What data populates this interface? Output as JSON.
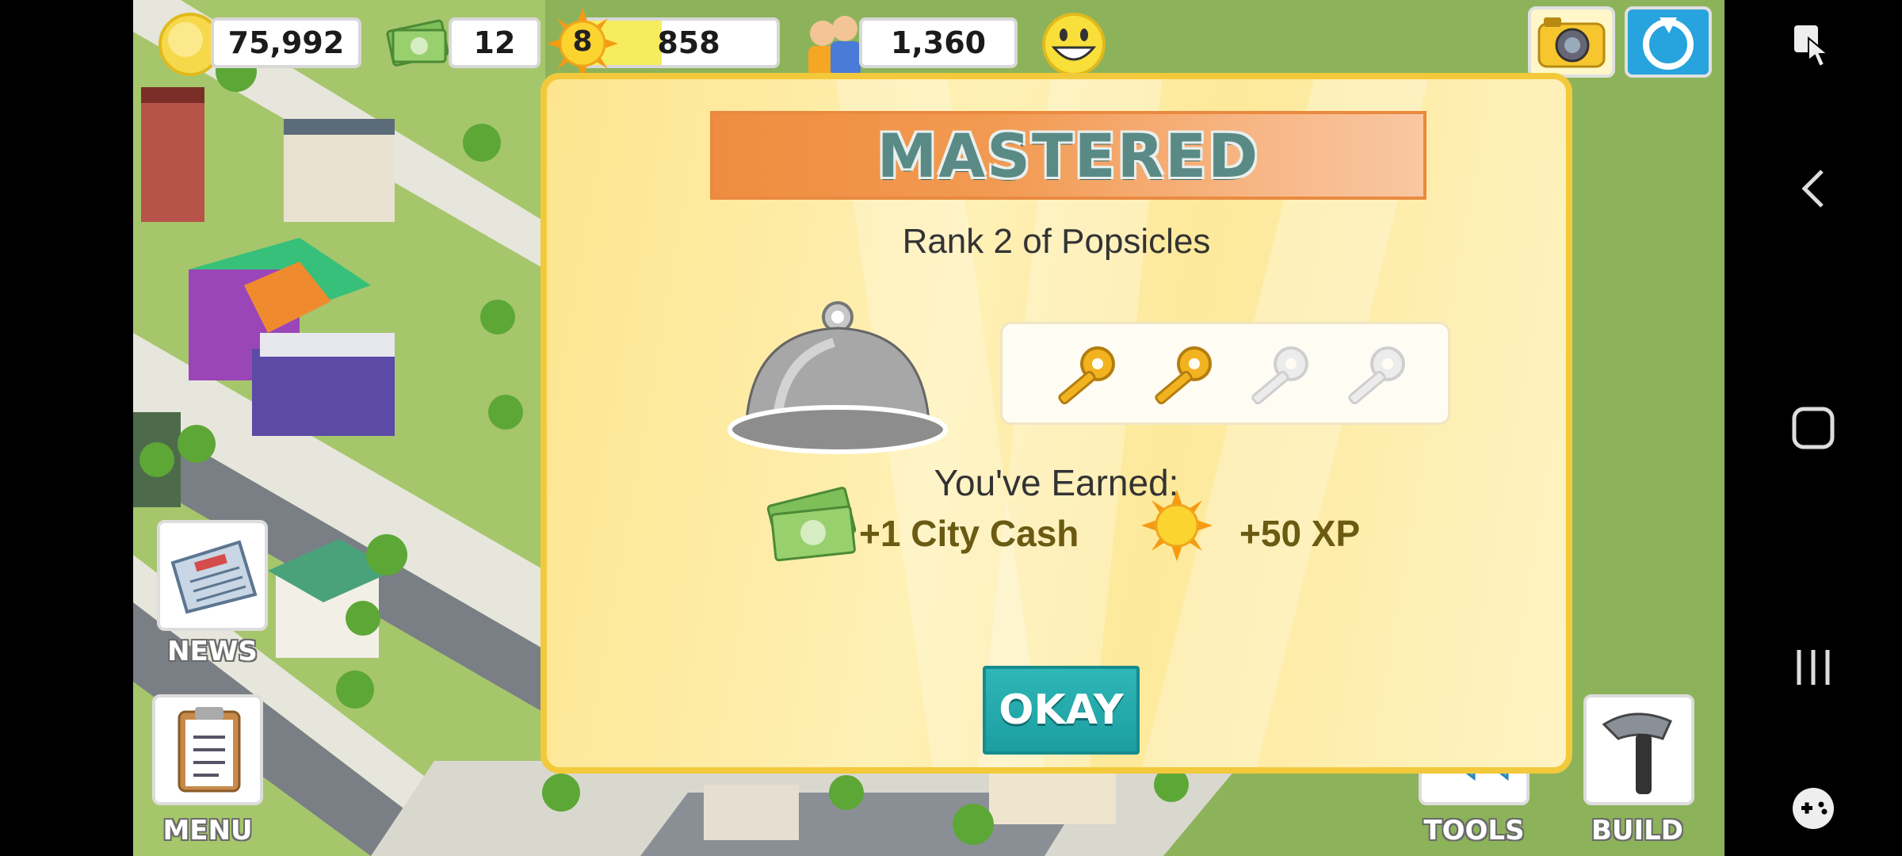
{
  "hud": {
    "coins": "75,992",
    "cash": "12",
    "level": "8",
    "xp": "858",
    "population": "1,360"
  },
  "modal": {
    "banner": "MASTERED",
    "subtitle": "Rank 2 of Popsicles",
    "keys_earned": 2,
    "keys_total": 4,
    "earned_heading": "You've Earned:",
    "reward_cash": "+1 City Cash",
    "reward_xp": "+50 XP",
    "okay_label": "OKAY"
  },
  "side_buttons": {
    "news": "NEWS",
    "menu": "MENU",
    "tools": "TOOLS",
    "build": "BUILD"
  },
  "colors": {
    "accent": "#2aaeb0",
    "banner": "#ee8d3f",
    "key_gold": "#f2b320"
  }
}
